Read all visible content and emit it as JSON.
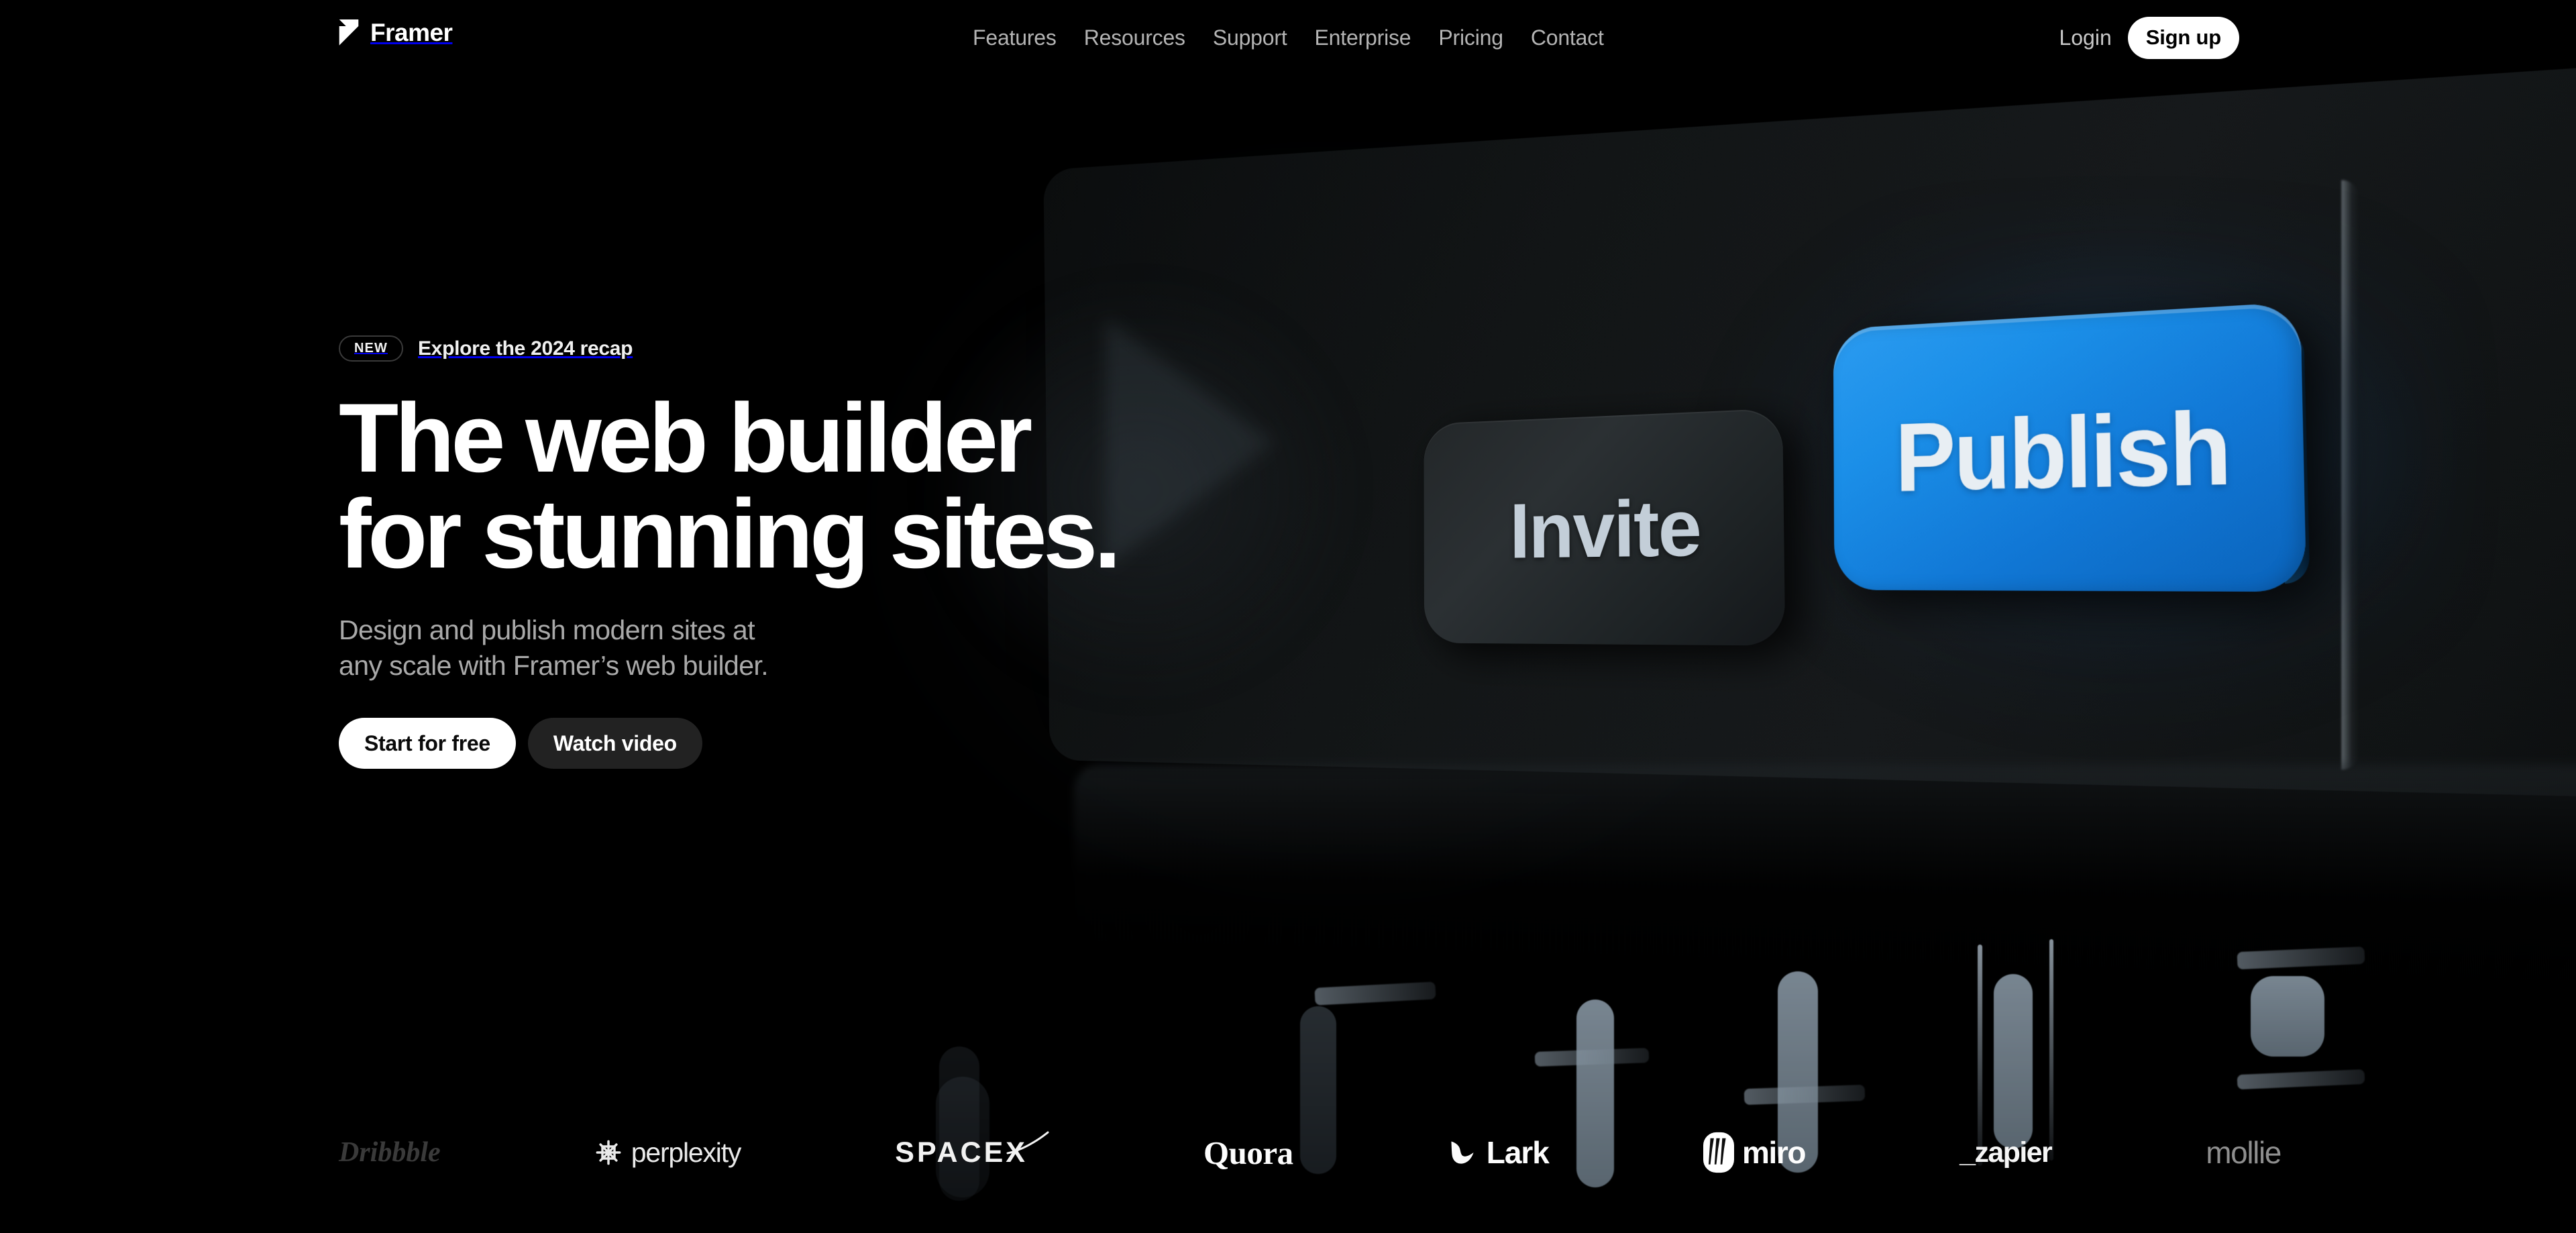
{
  "brand": {
    "name": "Framer",
    "logo_icon": "framer-logo-icon"
  },
  "nav": {
    "items": [
      {
        "label": "Features"
      },
      {
        "label": "Resources"
      },
      {
        "label": "Support"
      },
      {
        "label": "Enterprise"
      },
      {
        "label": "Pricing"
      },
      {
        "label": "Contact"
      }
    ]
  },
  "auth": {
    "login_label": "Login",
    "signup_label": "Sign up"
  },
  "hero": {
    "announcement": {
      "badge": "NEW",
      "text": "Explore the 2024 recap"
    },
    "headline_line1": "The web builder",
    "headline_line2": "for stunning sites.",
    "subtitle_line1": "Design and publish modern sites at",
    "subtitle_line2": "any scale with Framer’s web builder.",
    "primary_cta": "Start for free",
    "secondary_cta": "Watch video"
  },
  "artwork": {
    "invite_button_label": "Invite",
    "publish_button_label": "Publish",
    "publish_color": "#1b8fe8",
    "invite_color": "#2b3033",
    "panel_color": "#16191b"
  },
  "logos": {
    "items": [
      {
        "name": "Dribbble",
        "icon": "dribbble-logo-icon"
      },
      {
        "name": "perplexity",
        "icon": "perplexity-logo-icon"
      },
      {
        "name": "SPACEX",
        "icon": "spacex-logo-icon"
      },
      {
        "name": "Quora",
        "icon": "quora-logo-icon"
      },
      {
        "name": "Lark",
        "icon": "lark-logo-icon"
      },
      {
        "name": "miro",
        "icon": "miro-logo-icon"
      },
      {
        "name": "_zapier",
        "icon": "zapier-logo-icon"
      },
      {
        "name": "mollie",
        "icon": "mollie-logo-icon"
      }
    ]
  },
  "theme": {
    "background": "#000000",
    "text_primary": "#ffffff",
    "text_secondary": "#a9a9a9",
    "nav_link": "#b4b4b4",
    "accent_blue": "#1b8fe8",
    "button_dark": "#222222"
  }
}
